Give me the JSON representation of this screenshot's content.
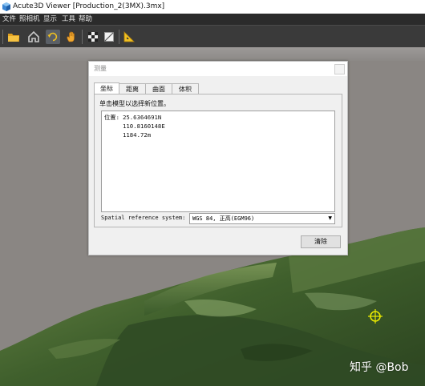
{
  "window": {
    "title": "Acute3D Viewer [Production_2(3MX).3mx]"
  },
  "menu": {
    "items": [
      "文件",
      "照相机",
      "显示",
      "工具",
      "帮助"
    ]
  },
  "toolbar": {
    "buttons": [
      "open-folder",
      "home",
      "rotate",
      "pan",
      "checkerboard",
      "tile",
      "measure"
    ],
    "active": "rotate"
  },
  "dialog": {
    "title": "测量",
    "tabs": [
      "坐标",
      "距离",
      "曲面",
      "体积"
    ],
    "active_tab": "坐标",
    "hint": "单击模型以选择新位置。",
    "position": {
      "label": "位置:",
      "lat": "25.6364691N",
      "lon": "110.8160148E",
      "alt": "1184.72m"
    },
    "srs_label": "Spatial reference system:",
    "srs_value": "WGS 84, 正高(EGM96)",
    "clear_label": "清除"
  },
  "watermark": "知乎 @Bob",
  "colors": {
    "accent_target": "#e8e800",
    "sky": "#8a8683"
  }
}
